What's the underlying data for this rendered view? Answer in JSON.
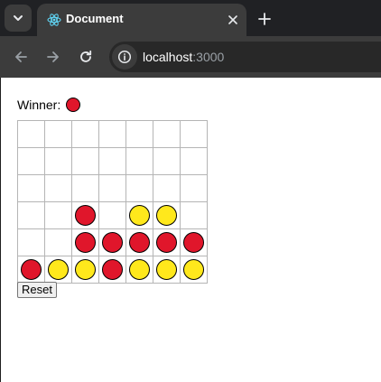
{
  "colors": {
    "red": "#e0162b",
    "yellow": "#ffe81c"
  },
  "browser": {
    "tab": {
      "title": "Document",
      "favicon": "react-logo-icon",
      "close_icon": "close-icon"
    },
    "new_tab_icon": "plus-icon",
    "tab_search_icon": "chevron-down-icon",
    "nav": {
      "back_icon": "back-arrow-icon",
      "forward_icon": "forward-arrow-icon",
      "reload_icon": "reload-icon"
    },
    "address": {
      "site_info_icon": "info-icon",
      "host": "localhost",
      "port": ":3000"
    }
  },
  "game": {
    "winner_label": "Winner:",
    "winner": "red",
    "reset_label": "Reset",
    "columns": 7,
    "rows": 6,
    "board": [
      [
        null,
        null,
        null,
        null,
        null,
        null,
        null
      ],
      [
        null,
        null,
        null,
        null,
        null,
        null,
        null
      ],
      [
        null,
        null,
        null,
        null,
        null,
        null,
        null
      ],
      [
        null,
        null,
        "red",
        null,
        "yellow",
        "yellow",
        null
      ],
      [
        null,
        null,
        "red",
        "red",
        "red",
        "red",
        "red"
      ],
      [
        "red",
        "yellow",
        "yellow",
        "red",
        "yellow",
        "yellow",
        "yellow"
      ]
    ]
  }
}
